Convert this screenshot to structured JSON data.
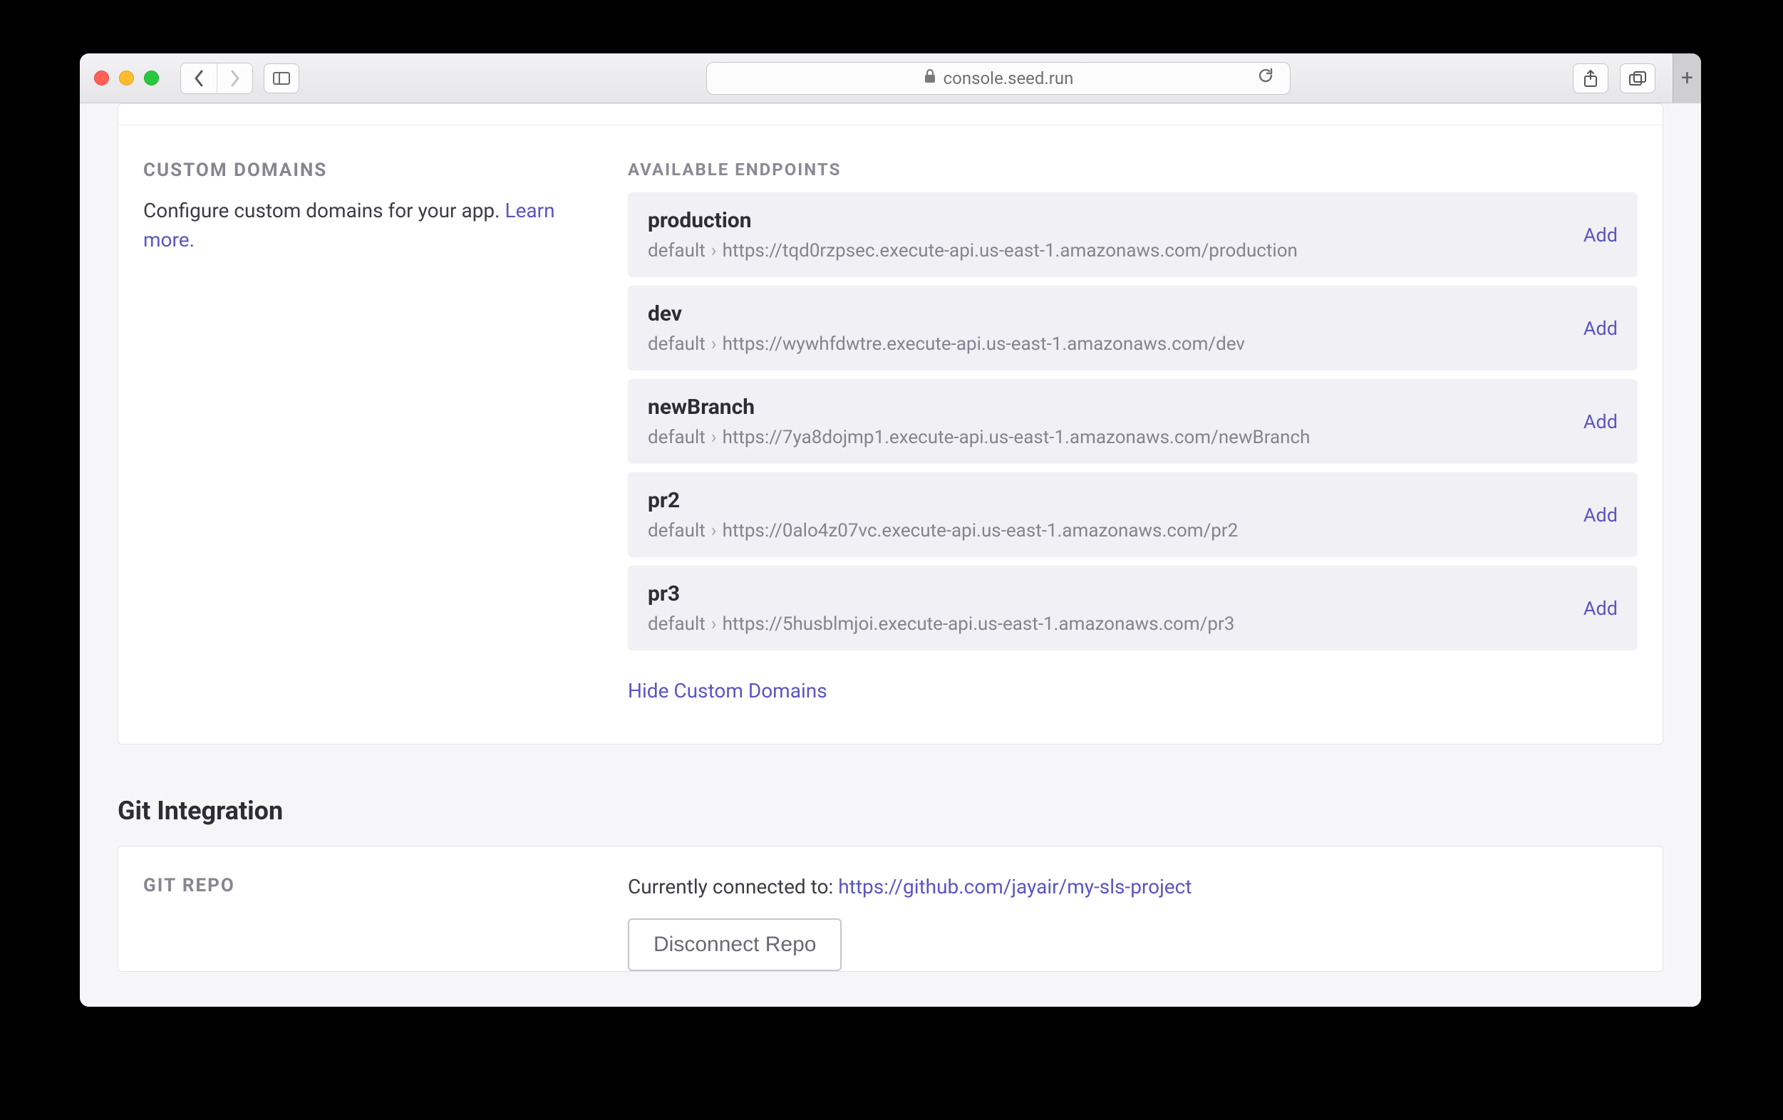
{
  "browser": {
    "url_host": "console.seed.run"
  },
  "custom_domains": {
    "heading": "CUSTOM DOMAINS",
    "description": "Configure custom domains for your app. ",
    "learn_more": "Learn more.",
    "endpoints_label": "AVAILABLE ENDPOINTS",
    "add_label": "Add",
    "hide_link": "Hide Custom Domains",
    "endpoints": [
      {
        "name": "production",
        "stage": "default",
        "url": "https://tqd0rzpsec.execute-api.us-east-1.amazonaws.com/production"
      },
      {
        "name": "dev",
        "stage": "default",
        "url": "https://wywhfdwtre.execute-api.us-east-1.amazonaws.com/dev"
      },
      {
        "name": "newBranch",
        "stage": "default",
        "url": "https://7ya8dojmp1.execute-api.us-east-1.amazonaws.com/newBranch"
      },
      {
        "name": "pr2",
        "stage": "default",
        "url": "https://0alo4z07vc.execute-api.us-east-1.amazonaws.com/pr2"
      },
      {
        "name": "pr3",
        "stage": "default",
        "url": "https://5husblmjoi.execute-api.us-east-1.amazonaws.com/pr3"
      }
    ]
  },
  "git": {
    "section_title": "Git Integration",
    "heading": "GIT REPO",
    "connected_prefix": "Currently connected to: ",
    "repo_url": "https://github.com/jayair/my-sls-project",
    "disconnect_label": "Disconnect Repo"
  }
}
